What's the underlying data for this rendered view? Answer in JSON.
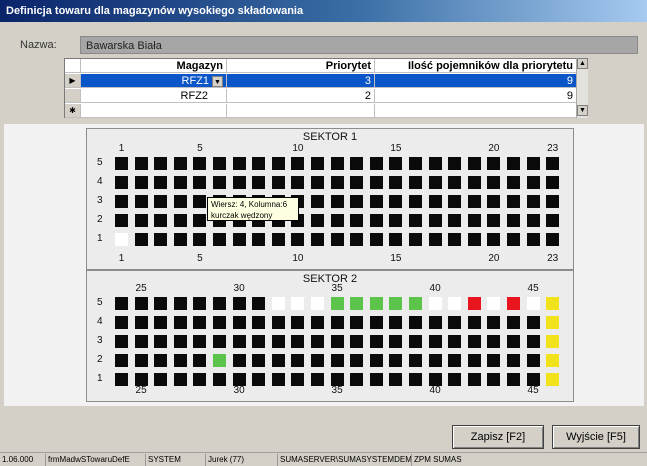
{
  "window": {
    "title": "Definicja towaru dla magazynów wysokiego składowania"
  },
  "name_field": {
    "label": "Nazwa:",
    "value": "Bawarska Biała"
  },
  "grid": {
    "columns": [
      "Magazyn",
      "Priorytet",
      "Ilość pojemników dla priorytetu"
    ],
    "rows": [
      {
        "marker": "▶",
        "magazyn": "RFZ1",
        "priorytet": "3",
        "ilosc": "9",
        "selected": true
      },
      {
        "marker": "",
        "magazyn": "RFZ2",
        "priorytet": "2",
        "ilosc": "9",
        "selected": false
      },
      {
        "marker": "✱",
        "magazyn": "",
        "priorytet": "",
        "ilosc": "",
        "selected": false
      }
    ],
    "scroll_up": "▲",
    "scroll_down": "▼",
    "dropdown_arrow": "▼"
  },
  "sector1": {
    "title": "SEKTOR 1",
    "column_labels": [
      "1",
      "5",
      "10",
      "15",
      "20",
      "23"
    ],
    "row_labels": [
      "5",
      "4",
      "3",
      "2",
      "1"
    ],
    "columns": 23,
    "tooltip": {
      "line1": "Wiersz: 4, Kolumna:6",
      "line2": "kurczak wędzony"
    },
    "cells": [
      "BBBBBBBBBBBBBBBBBBBBBBB",
      "BBBBBBBBBBBBBBBBBBBBBBB",
      "BBBBBBBBBBBBBBBBBBBBBBB",
      "BBBBBBBBBBBBBBBBBBBBBBB",
      "WBBBBBBBBBBBBBBBBBBBBBB"
    ]
  },
  "sector2": {
    "title": "SEKTOR 2",
    "column_labels": [
      "25",
      "30",
      "35",
      "40",
      "45"
    ],
    "row_labels": [
      "5",
      "4",
      "3",
      "2",
      "1"
    ],
    "columns": 23,
    "cells": [
      "BBBBBBBBWWWGGGGGWWRWRWY",
      "BBBBBBBBBBBBBBBBBBBBBBY",
      "BBBBBBBBBBBBBBBBBBBBBBY",
      "BBBBBGBBBBBBBBBBBBBBBBY",
      "BBBBBBBBBBBBBBBBBBBBBBY"
    ]
  },
  "cell_colors": {
    "B": "#0a0a0a",
    "W": "#ffffff",
    "G": "#5cc44a",
    "R": "#e8141e",
    "Y": "#f2e21c"
  },
  "buttons": {
    "save": "Zapisz [F2]",
    "exit": "Wyjście [F5]"
  },
  "statusbar": [
    "1.06.000",
    "frmMadwSTowaruDefE",
    "SYSTEM",
    "Jurek (77)",
    "SUMASERVER\\SUMASYSTEMDEMO",
    "ZPM SUMAS"
  ]
}
